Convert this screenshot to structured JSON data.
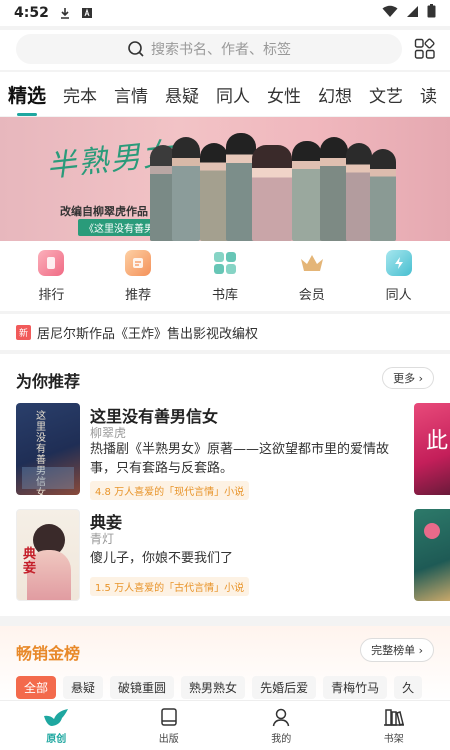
{
  "status_bar": {
    "time": "4:52"
  },
  "search": {
    "placeholder": "搜索书名、作者、标签"
  },
  "tabs": [
    {
      "label": "精选",
      "active": true
    },
    {
      "label": "完本"
    },
    {
      "label": "言情"
    },
    {
      "label": "悬疑"
    },
    {
      "label": "同人"
    },
    {
      "label": "女性"
    },
    {
      "label": "幻想"
    },
    {
      "label": "文艺"
    },
    {
      "label": "读"
    }
  ],
  "banner": {
    "title_art": "半熟男女",
    "caption": "改编自柳翠虎作品",
    "tagline": "《这里没有善男信女》"
  },
  "quick_entries": [
    {
      "label": "排行",
      "icon": "rank-icon",
      "color": "#f47a8c"
    },
    {
      "label": "推荐",
      "icon": "recommend-icon",
      "color": "#f5a25d"
    },
    {
      "label": "书库",
      "icon": "library-icon",
      "color": "#67c6b6"
    },
    {
      "label": "会员",
      "icon": "crown-icon",
      "color": "#d9a86a"
    },
    {
      "label": "同人",
      "icon": "fanfic-icon",
      "color": "#5cc7d4"
    }
  ],
  "news": {
    "badge": "新",
    "text": "居尼尔斯作品《王炸》售出影视改编权"
  },
  "recommend": {
    "title": "为你推荐",
    "more_label": "更多",
    "books": [
      {
        "title": "这里没有善男信女",
        "author": "柳翠虎",
        "desc": "热播剧《半熟男女》原著——这欲望都市里的爱情故事，只有套路与反套路。",
        "tag": "4.8 万人喜爱的「现代言情」小说",
        "cover_text": "这里没有善男信女"
      },
      {
        "title": "典妾",
        "author": "青灯",
        "desc": "傻儿子，你娘不要我们了",
        "tag": "1.5 万人喜爱的「古代言情」小说",
        "cover_text": "典妾"
      }
    ]
  },
  "bestseller": {
    "title": "畅销金榜",
    "rank_label": "完整榜单",
    "chips": [
      "全部",
      "悬疑",
      "破镜重圆",
      "熟男熟女",
      "先婚后爱",
      "青梅竹马",
      "久"
    ]
  },
  "bottom_nav": [
    {
      "label": "原创",
      "icon": "bird-icon",
      "active": true
    },
    {
      "label": "出版",
      "icon": "book-icon"
    },
    {
      "label": "我的",
      "icon": "person-icon"
    },
    {
      "label": "书架",
      "icon": "bookshelf-icon"
    }
  ]
}
